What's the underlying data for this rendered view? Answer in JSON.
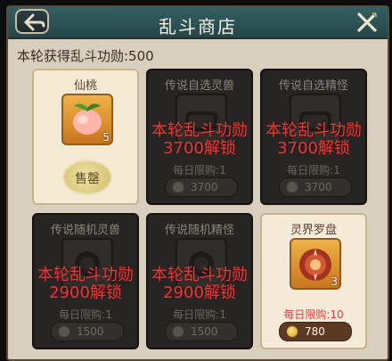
{
  "header": {
    "title": "乱斗商店"
  },
  "points_label": "本轮获得乱斗功勋:500",
  "cards": [
    {
      "name": "仙桃",
      "state": "available_sold",
      "qty": "5",
      "sold_label": "售罄"
    },
    {
      "name": "传说自选灵兽",
      "state": "locked",
      "lock_text": "本轮乱斗功勋3700解锁",
      "limit": "每日限购:1",
      "price": "3700"
    },
    {
      "name": "传说自选精怪",
      "state": "locked",
      "lock_text": "本轮乱斗功勋3700解锁",
      "limit": "每日限购:1",
      "price": "3700"
    },
    {
      "name": "传说随机灵兽",
      "state": "locked",
      "lock_text": "本轮乱斗功勋2900解锁",
      "limit": "每日限购:1",
      "price": "1500"
    },
    {
      "name": "传说随机精怪",
      "state": "locked",
      "lock_text": "本轮乱斗功勋2900解锁",
      "limit": "每日限购:1",
      "price": "1500"
    },
    {
      "name": "灵界罗盘",
      "state": "available",
      "qty": "3",
      "limit": "每日限购:10",
      "price": "780"
    }
  ]
}
